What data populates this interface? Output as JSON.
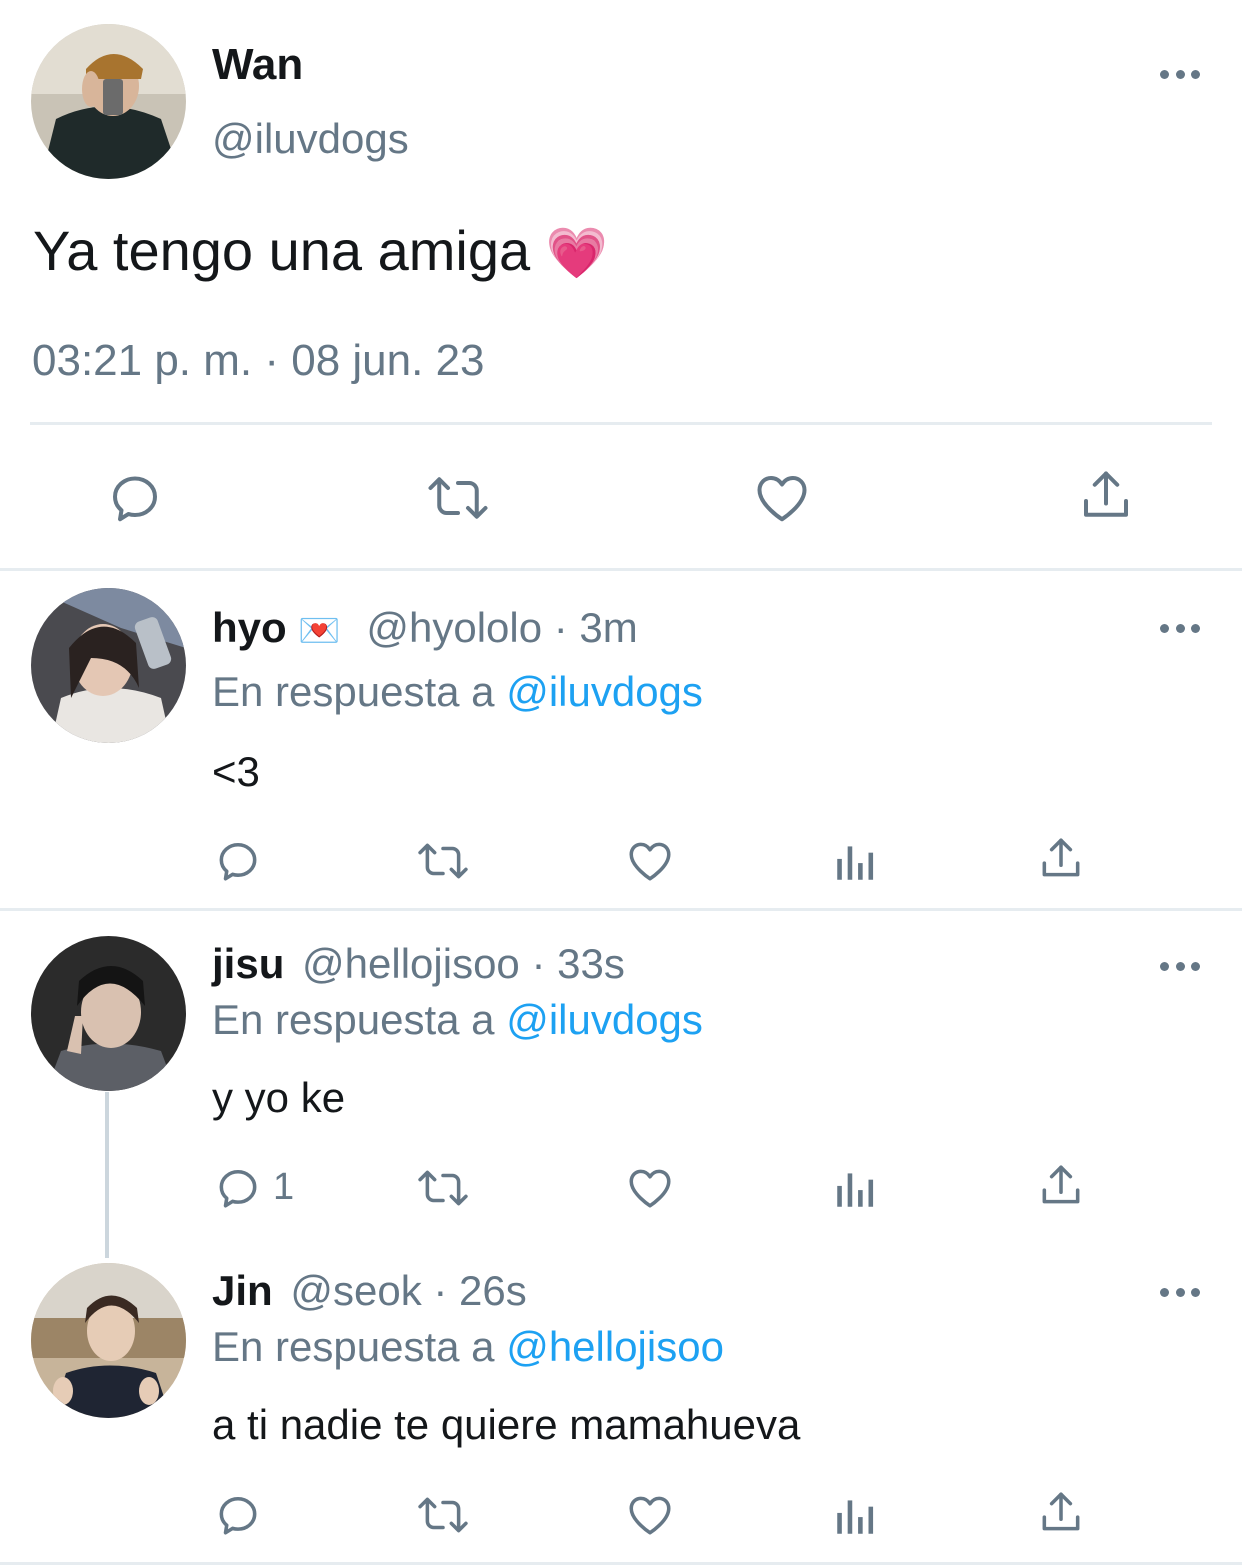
{
  "main_tweet": {
    "name": "Wan",
    "handle": "@iluvdogs",
    "text": "Ya tengo una amiga",
    "emoji": "💗",
    "timestamp": "03:21 p. m. · 08 jun. 23"
  },
  "replies": [
    {
      "name": "hyo",
      "name_emoji": "💌",
      "meta": "@hyololo · 3m",
      "reply_prefix": "En respuesta a",
      "reply_to": "@iluvdogs",
      "text": "<3",
      "reply_count": ""
    },
    {
      "name": "jisu",
      "meta": "@hellojisoo · 33s",
      "reply_prefix": "En respuesta a",
      "reply_to": "@iluvdogs",
      "text": "y yo ke",
      "reply_count": "1"
    },
    {
      "name": "Jin",
      "meta": "@seok · 26s",
      "reply_prefix": "En respuesta a",
      "reply_to": "@hellojisoo",
      "text": "a ti nadie te quiere mamahueva",
      "reply_count": ""
    }
  ],
  "colors": {
    "text": "#14171a",
    "secondary": "#657786",
    "link": "#1da1f2",
    "divider": "#e6ecf0",
    "icon": "#657786"
  },
  "icons": [
    "reply-icon",
    "retweet-icon",
    "like-icon",
    "share-icon",
    "analytics-icon",
    "more-icon"
  ]
}
